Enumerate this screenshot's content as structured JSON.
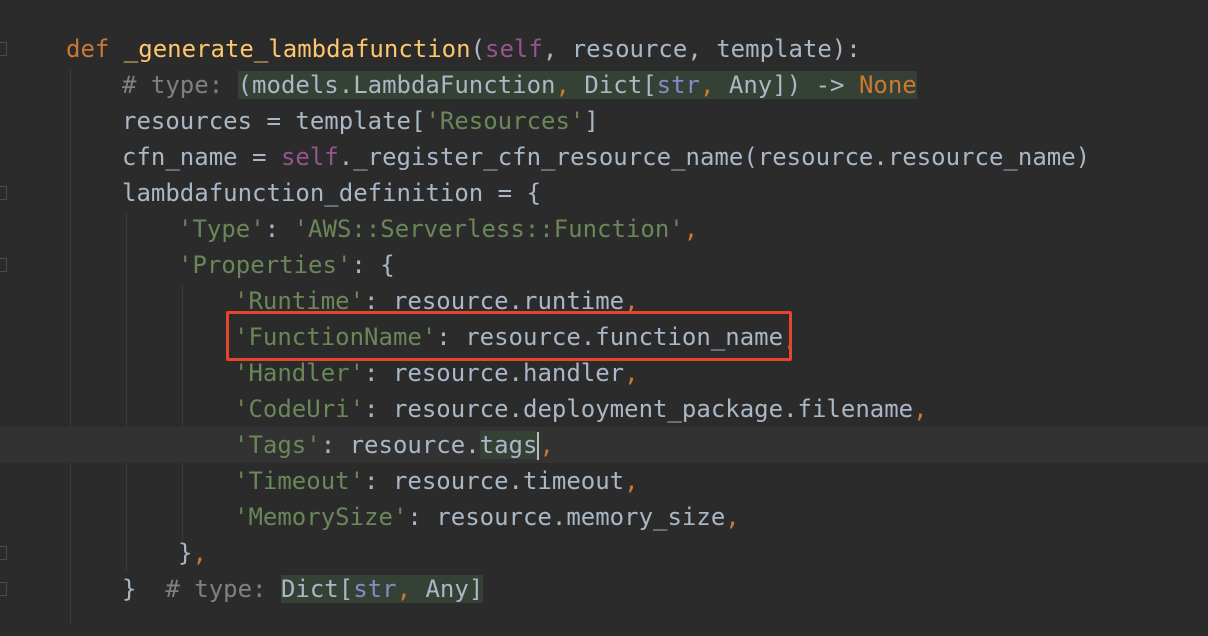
{
  "editor": {
    "lines": [
      {
        "id": "l1",
        "parts": [
          {
            "t": "def ",
            "c": "kw"
          },
          {
            "t": "_generate_lambdafunction",
            "c": "fn"
          },
          {
            "t": "(",
            "c": ""
          },
          {
            "t": "self",
            "c": "self"
          },
          {
            "t": ", resource, template):",
            "c": ""
          }
        ]
      },
      {
        "id": "l2",
        "parts": [
          {
            "t": "# type: ",
            "c": "cm"
          },
          {
            "t": "(models.LambdaFunction",
            "c": "hl"
          },
          {
            "t": ", ",
            "c": "hl kw"
          },
          {
            "t": "Dict[",
            "c": "hl"
          },
          {
            "t": "str",
            "c": "hl bi"
          },
          {
            "t": ", ",
            "c": "hl kw"
          },
          {
            "t": "Any]) -> ",
            "c": "hl"
          },
          {
            "t": "None",
            "c": "hl none"
          }
        ]
      },
      {
        "id": "l3",
        "parts": [
          {
            "t": "resources = template[",
            "c": ""
          },
          {
            "t": "'Resources'",
            "c": "str"
          },
          {
            "t": "]",
            "c": ""
          }
        ]
      },
      {
        "id": "l4",
        "parts": [
          {
            "t": "cfn_name = ",
            "c": ""
          },
          {
            "t": "self",
            "c": "self"
          },
          {
            "t": "._register_cfn_resource_name(resource.resource_name)",
            "c": ""
          }
        ]
      },
      {
        "id": "l5",
        "parts": [
          {
            "t": "lambdafunction_definition = {",
            "c": ""
          }
        ]
      },
      {
        "id": "l6",
        "parts": [
          {
            "t": "'Type'",
            "c": "str"
          },
          {
            "t": ": ",
            "c": ""
          },
          {
            "t": "'AWS::Serverless::Function'",
            "c": "str"
          },
          {
            "t": ",",
            "c": "kw"
          }
        ]
      },
      {
        "id": "l7",
        "parts": [
          {
            "t": "'Properties'",
            "c": "str"
          },
          {
            "t": ": {",
            "c": ""
          }
        ]
      },
      {
        "id": "l8",
        "parts": [
          {
            "t": "'Runtime'",
            "c": "str"
          },
          {
            "t": ": resource.runtime",
            "c": ""
          },
          {
            "t": ",",
            "c": "kw"
          }
        ]
      },
      {
        "id": "l9",
        "parts": [
          {
            "t": "'FunctionName'",
            "c": "str"
          },
          {
            "t": ": resource.function_name",
            "c": ""
          },
          {
            "t": ",",
            "c": "kw"
          }
        ]
      },
      {
        "id": "l10",
        "parts": [
          {
            "t": "'Handler'",
            "c": "str"
          },
          {
            "t": ": resource.handler",
            "c": ""
          },
          {
            "t": ",",
            "c": "kw"
          }
        ]
      },
      {
        "id": "l11",
        "parts": [
          {
            "t": "'CodeUri'",
            "c": "str"
          },
          {
            "t": ": resource.deployment_package.filename",
            "c": ""
          },
          {
            "t": ",",
            "c": "kw"
          }
        ]
      },
      {
        "id": "l12",
        "parts": [
          {
            "t": "'Tags'",
            "c": "str"
          },
          {
            "t": ": resource.",
            "c": ""
          },
          {
            "t": "tags",
            "c": "hl"
          },
          {
            "t": "|",
            "c": "caret"
          },
          {
            "t": ",",
            "c": "kw"
          }
        ]
      },
      {
        "id": "l13",
        "parts": [
          {
            "t": "'Timeout'",
            "c": "str"
          },
          {
            "t": ": resource.timeout",
            "c": ""
          },
          {
            "t": ",",
            "c": "kw"
          }
        ]
      },
      {
        "id": "l14",
        "parts": [
          {
            "t": "'MemorySize'",
            "c": "str"
          },
          {
            "t": ": resource.memory_size",
            "c": ""
          },
          {
            "t": ",",
            "c": "kw"
          }
        ]
      },
      {
        "id": "l15",
        "parts": [
          {
            "t": "}",
            "c": ""
          },
          {
            "t": ",",
            "c": "kw"
          }
        ]
      },
      {
        "id": "l16",
        "parts": [
          {
            "t": "}  ",
            "c": ""
          },
          {
            "t": "# type: ",
            "c": "cm"
          },
          {
            "t": "Dict[",
            "c": "hl"
          },
          {
            "t": "str",
            "c": "hl bi"
          },
          {
            "t": ", ",
            "c": "hl kw"
          },
          {
            "t": "Any]",
            "c": "hl"
          }
        ]
      }
    ]
  },
  "colors": {
    "background": "#2b2b2b",
    "keyword": "#cc7832",
    "function": "#ffc66d",
    "string": "#6a8759",
    "comment": "#808080",
    "highlight_box": "#e4452e"
  }
}
